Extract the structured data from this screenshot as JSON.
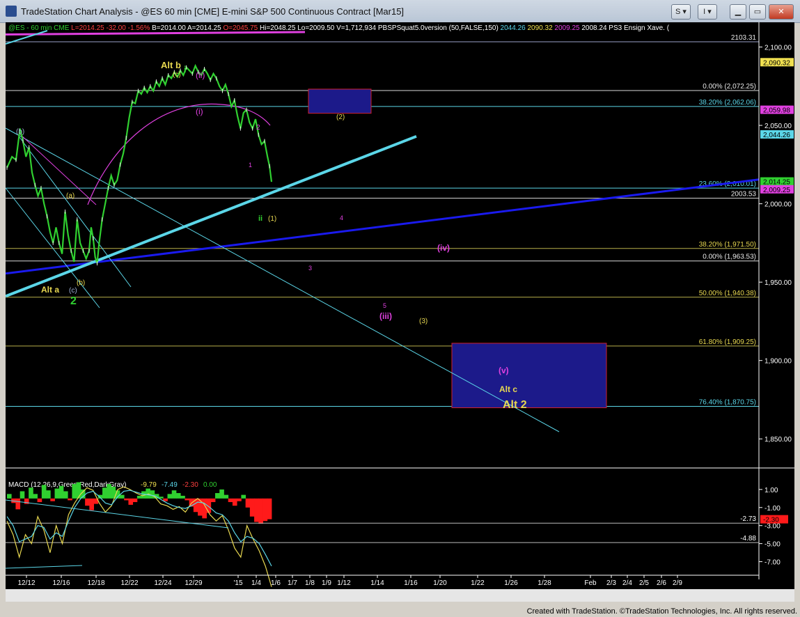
{
  "window": {
    "title": "TradeStation Chart Analysis - @ES 60 min [CME] E-mini S&P 500 Continuous Contract [Mar15]",
    "controls": {
      "s_label": "S",
      "i_label": "I"
    }
  },
  "footer": "Created with TradeStation. ©TradeStation Technologies, Inc. All rights reserved.",
  "colors": {
    "background": "#000000",
    "cyan": "#5bd6e8",
    "magenta": "#e040e0",
    "blue": "#1a1aee",
    "yellow": "#e8d850",
    "green": "#30d030",
    "red": "#ff1a1a",
    "box_fill": "#1c1a8a",
    "box_border": "#d0202a"
  },
  "chart_data": [
    {
      "type": "line",
      "header": {
        "symbol": "@ES - 60 min  CME",
        "items": [
          "L=2014.25",
          "-32.00",
          "-1.56%",
          "B=2014.00",
          "A=2014.25",
          "O=2045.75",
          "Hi=2048.25",
          "Lo=2009.50",
          "V=1,712,934",
          "PBSPSquat5.0version (50,FALSE,150)",
          "2044.26",
          "2090.32",
          "2009.25",
          "2008.24",
          "PS3 Ensign Xave. ("
        ]
      },
      "ylim": [
        1835,
        2114
      ],
      "y_ticks": [
        2100,
        2050,
        2000,
        1950,
        1900,
        1850
      ],
      "y_tick_labels": [
        "2,100.00",
        "2,050.00",
        "2,000.00",
        "1,950.00",
        "1,900.00",
        "1,850.00"
      ],
      "x_tick_labels": [
        "12/12",
        "12/16",
        "12/18",
        "12/22",
        "12/24",
        "12/29",
        "'15",
        "1/4",
        "1/6",
        "1/7",
        "1/8",
        "1/9",
        "1/12",
        "1/14",
        "1/16",
        "1/20",
        "1/22",
        "1/26",
        "1/28",
        "Feb",
        "2/3",
        "2/4",
        "2/5",
        "2/6",
        "2/9"
      ],
      "price_series": {
        "name": "@ES 60 min",
        "points": [
          [
            0,
            2023
          ],
          [
            5,
            2030
          ],
          [
            9,
            2028
          ],
          [
            13,
            2048
          ],
          [
            16,
            2040
          ],
          [
            19,
            2030
          ],
          [
            22,
            2036
          ],
          [
            25,
            2020
          ],
          [
            28,
            2012
          ],
          [
            31,
            2005
          ],
          [
            34,
            2010
          ],
          [
            37,
            2000
          ],
          [
            40,
            1992
          ],
          [
            43,
            1982
          ],
          [
            46,
            1975
          ],
          [
            49,
            1985
          ],
          [
            52,
            1975
          ],
          [
            55,
            1968
          ],
          [
            58,
            1995
          ],
          [
            61,
            1980
          ],
          [
            64,
            1970
          ],
          [
            67,
            1963
          ],
          [
            70,
            1990
          ],
          [
            73,
            1975
          ],
          [
            76,
            1970
          ],
          [
            79,
            1965
          ],
          [
            82,
            1970
          ],
          [
            84,
            1985
          ],
          [
            86,
            1978
          ],
          [
            88,
            1966
          ],
          [
            90,
            1962
          ],
          [
            92,
            1975
          ],
          [
            95,
            1990
          ],
          [
            98,
            2000
          ],
          [
            101,
            2010
          ],
          [
            104,
            2018
          ],
          [
            107,
            2012
          ],
          [
            110,
            2015
          ],
          [
            113,
            2025
          ],
          [
            116,
            2032
          ],
          [
            119,
            2042
          ],
          [
            122,
            2055
          ],
          [
            125,
            2065
          ],
          [
            128,
            2064
          ],
          [
            131,
            2072
          ],
          [
            134,
            2070
          ],
          [
            137,
            2074
          ],
          [
            140,
            2071
          ],
          [
            143,
            2075
          ],
          [
            146,
            2072
          ],
          [
            149,
            2078
          ],
          [
            152,
            2075
          ],
          [
            155,
            2080
          ],
          [
            158,
            2076
          ],
          [
            161,
            2082
          ],
          [
            164,
            2080
          ],
          [
            167,
            2084
          ],
          [
            170,
            2081
          ],
          [
            173,
            2085
          ],
          [
            176,
            2082
          ],
          [
            179,
            2087
          ],
          [
            182,
            2085
          ],
          [
            185,
            2083
          ],
          [
            188,
            2088
          ],
          [
            191,
            2084
          ],
          [
            194,
            2082
          ],
          [
            197,
            2086
          ],
          [
            200,
            2083
          ],
          [
            203,
            2079
          ],
          [
            206,
            2083
          ],
          [
            209,
            2080
          ],
          [
            212,
            2075
          ],
          [
            215,
            2072
          ],
          [
            218,
            2076
          ],
          [
            221,
            2070
          ],
          [
            224,
            2062
          ],
          [
            227,
            2066
          ],
          [
            230,
            2056
          ],
          [
            233,
            2048
          ],
          [
            236,
            2058
          ],
          [
            239,
            2060
          ],
          [
            242,
            2052
          ],
          [
            245,
            2048
          ],
          [
            248,
            2054
          ],
          [
            251,
            2044
          ],
          [
            254,
            2038
          ],
          [
            257,
            2040
          ],
          [
            260,
            2030
          ],
          [
            262,
            2024
          ],
          [
            264,
            2014
          ]
        ],
        "note_x_index_units": "hour bar index; x labels as shown on axis"
      },
      "lines": [
        {
          "name": "blue trendline",
          "from": [
            1955.5,
            0
          ],
          "to": [
            2015.5,
            1
          ]
        },
        {
          "name": "cyan trendline",
          "from": [
            1941,
            0
          ],
          "to": [
            2043,
            1
          ]
        },
        {
          "name": "magenta channel",
          "from": [
            2108,
            0
          ],
          "to": [
            2114,
            1
          ]
        }
      ],
      "horizontal_levels": [
        {
          "value": 2103.31,
          "label": "2103.31"
        },
        {
          "value": 2072.25,
          "label": "0.00% (2,072.25)"
        },
        {
          "value": 2062.06,
          "label": "38.20% (2,062.06)"
        },
        {
          "value": 2010.01,
          "label": "23.60% (2,010.01)"
        },
        {
          "value": 2003.53,
          "label": "2003.53"
        },
        {
          "value": 1971.5,
          "label": "38.20% (1,971.50)"
        },
        {
          "value": 1963.53,
          "label": "0.00% (1,963.53)"
        },
        {
          "value": 1940.38,
          "label": "50.00% (1,940.38)"
        },
        {
          "value": 1909.25,
          "label": "61.80% (1,909.25)"
        },
        {
          "value": 1870.75,
          "label": "76.40% (1,870.75)"
        }
      ],
      "price_tags": [
        {
          "value": 2090.32,
          "label": "2,090.32",
          "bg": "#f0e050",
          "fg": "#000"
        },
        {
          "value": 2059.98,
          "label": "2,059.98",
          "bg": "#e040e0",
          "fg": "#000"
        },
        {
          "value": 2044.26,
          "label": "2,044.26",
          "bg": "#5bd6e8",
          "fg": "#000"
        },
        {
          "value": 2014.25,
          "label": "2,014.25",
          "bg": "#30d030",
          "fg": "#000"
        },
        {
          "value": 2009.25,
          "label": "2,009.25",
          "bg": "#e040e0",
          "fg": "#000"
        }
      ],
      "target_boxes": [
        {
          "label": "(2)",
          "y_range": [
            2059.5,
            2072.25
          ]
        },
        {
          "label": "(v) / Alt c / Alt 2",
          "y_range": [
            1870.75,
            1909.25
          ]
        }
      ],
      "annotations": [
        {
          "text": "Alt b",
          "color": "#e8d850"
        },
        {
          "text": "i",
          "color": "#30d030"
        },
        {
          "text": "(ii)",
          "color": "#e040e0"
        },
        {
          "text": "(c)",
          "color": "#e8d850"
        },
        {
          "text": "(i)",
          "color": "#e040e0"
        },
        {
          "text": "(b)",
          "color": "#9fb0d8"
        },
        {
          "text": "(a)",
          "color": "#e8d850"
        },
        {
          "text": "2",
          "color": "#e040e0"
        },
        {
          "text": "1",
          "color": "#e040e0"
        },
        {
          "text": "ii",
          "color": "#30d030"
        },
        {
          "text": "(1)",
          "color": "#e8d850"
        },
        {
          "text": "4",
          "color": "#e040e0"
        },
        {
          "text": "(iv)",
          "color": "#e040e0"
        },
        {
          "text": "3",
          "color": "#e040e0"
        },
        {
          "text": "Alt a",
          "color": "#e8d850"
        },
        {
          "text": "(c)",
          "color": "#9fb0d8"
        },
        {
          "text": "(b)",
          "color": "#e8d850"
        },
        {
          "text": "2",
          "color": "#30d030"
        },
        {
          "text": "5",
          "color": "#e040e0"
        },
        {
          "text": "(iii)",
          "color": "#e040e0"
        },
        {
          "text": "(3)",
          "color": "#e8d850"
        },
        {
          "text": "(2)",
          "color": "#e8d850"
        },
        {
          "text": "(v)",
          "color": "#e040e0"
        },
        {
          "text": "Alt c",
          "color": "#e8d850"
        },
        {
          "text": "Alt 2",
          "color": "#e8d850"
        }
      ]
    },
    {
      "type": "bar",
      "title": "MACD (12,26,9,Green,Red,DarkGray)",
      "values_header": [
        "-9.79",
        "-7.49",
        "-2.30",
        "0.00"
      ],
      "ylim": [
        -8.5,
        2.3
      ],
      "y_ticks": [
        1.0,
        -1.0,
        -3.0,
        -5.0,
        -7.0
      ],
      "y_tick_labels": [
        "1.00",
        "-1.00",
        "-3.00",
        "-5.00",
        "-7.00"
      ],
      "levels": [
        {
          "value": -2.73,
          "label": "-2.73"
        },
        {
          "value": -4.88,
          "label": "-4.88"
        }
      ],
      "price_tag": {
        "value": -2.3,
        "label": "-2.30",
        "bg": "#ff1a1a"
      },
      "histogram": [
        0.5,
        -0.5,
        -1.2,
        0.8,
        -0.6,
        1.2,
        0.5,
        -0.4,
        1.5,
        0.9,
        -0.3,
        1.1,
        1.4,
        0.8,
        -0.2,
        1.6,
        1.8,
        1.0,
        -0.8,
        -1.3,
        -0.6,
        0.4,
        1.2,
        1.6,
        1.3,
        0.9,
        0.4,
        -0.2,
        -0.7,
        -0.4,
        0.3,
        0.8,
        1.1,
        0.9,
        0.5,
        0.2,
        -0.3,
        0.5,
        0.9,
        0.6,
        0.3,
        -0.2,
        -0.9,
        -1.5,
        -1.9,
        -2.2,
        -1.6,
        -0.4,
        0.6,
        1.0,
        0.4,
        -0.4,
        -0.8,
        -0.3,
        0.4,
        -1.0,
        -2.0,
        -2.6,
        -2.8,
        -2.5,
        -2.3
      ],
      "macd_line": [
        -2.5,
        -4.0,
        -6.5,
        -4.0,
        -5.0,
        -2.0,
        -3.5,
        -6.0,
        -3.0,
        -5.0,
        -1.8,
        -0.5,
        0.5,
        1.2,
        0.9,
        -0.5,
        -1.5,
        -0.8,
        1.0,
        1.3,
        1.0,
        0.6,
        0.3,
        0.5,
        0.2,
        -0.6,
        -0.8,
        -1.2,
        -0.9,
        -1.5,
        -0.5,
        0.0,
        -0.6,
        -1.8,
        -2.5,
        -1.9,
        -3.5,
        -5.5,
        -6.5,
        -3.0,
        -4.5,
        -5.8,
        -7.5,
        -9.79
      ],
      "signal_line": [
        -2.0,
        -3.0,
        -4.8,
        -4.5,
        -4.2,
        -3.0,
        -3.2,
        -4.5,
        -3.8,
        -4.2,
        -2.5,
        -1.0,
        0.0,
        0.6,
        0.8,
        0.2,
        -0.5,
        -0.7,
        0.2,
        0.8,
        0.9,
        0.7,
        0.5,
        0.4,
        0.3,
        -0.1,
        -0.5,
        -0.8,
        -1.0,
        -1.1,
        -0.8,
        -0.4,
        -0.5,
        -1.0,
        -1.6,
        -1.8,
        -2.5,
        -3.8,
        -4.8,
        -4.2,
        -4.4,
        -5.0,
        -6.2,
        -7.49
      ]
    }
  ]
}
